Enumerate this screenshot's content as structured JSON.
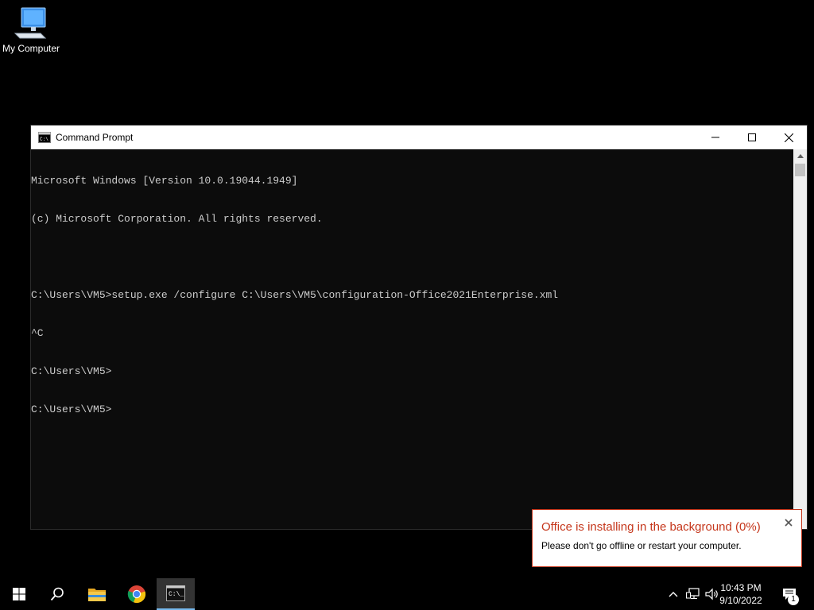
{
  "desktop": {
    "icons": [
      {
        "label": "My Computer",
        "icon": "computer-icon"
      }
    ]
  },
  "window": {
    "title": "Command Prompt",
    "app_icon": "cmd-icon",
    "controls": {
      "minimize": "minimize-icon",
      "maximize": "maximize-icon",
      "close": "close-icon"
    },
    "console_lines": [
      "Microsoft Windows [Version 10.0.19044.1949]",
      "(c) Microsoft Corporation. All rights reserved.",
      "",
      "C:\\Users\\VM5>setup.exe /configure C:\\Users\\VM5\\configuration-Office2021Enterprise.xml",
      "^C",
      "C:\\Users\\VM5>",
      "C:\\Users\\VM5>"
    ]
  },
  "toast": {
    "title": "Office is installing in the background (0%)",
    "progress_percent": 0,
    "body": "Please don't go offline or restart your computer.",
    "accent": "#c5361b"
  },
  "taskbar": {
    "buttons": [
      {
        "name": "start-button",
        "icon": "windows-logo-icon"
      },
      {
        "name": "search-button",
        "icon": "search-icon"
      },
      {
        "name": "file-explorer-button",
        "icon": "folder-icon"
      },
      {
        "name": "chrome-button",
        "icon": "chrome-icon"
      },
      {
        "name": "command-prompt-taskbar-button",
        "icon": "cmd-icon",
        "active": true
      }
    ],
    "clock": {
      "time": "10:43 PM",
      "date": "9/10/2022"
    },
    "notification_count": "1"
  }
}
